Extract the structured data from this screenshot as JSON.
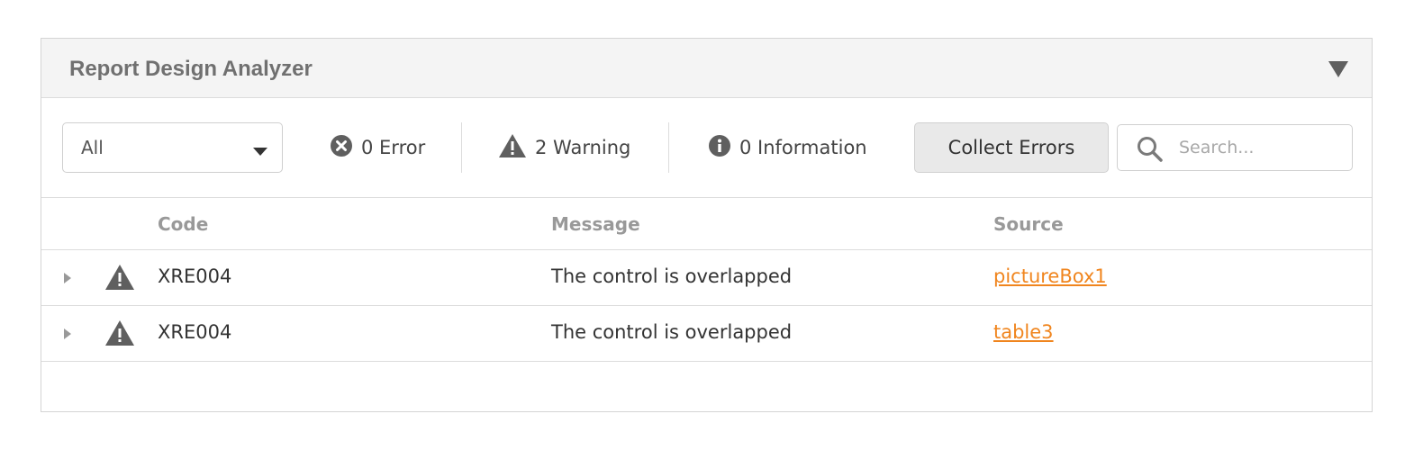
{
  "panel": {
    "title": "Report Design Analyzer"
  },
  "toolbar": {
    "filter": {
      "selected": "All"
    },
    "counters": {
      "error": "0 Error",
      "warning": "2 Warning",
      "information": "0 Information"
    },
    "collect_label": "Collect Errors",
    "search": {
      "placeholder": "Search...",
      "value": ""
    }
  },
  "table": {
    "columns": {
      "code": "Code",
      "message": "Message",
      "source": "Source"
    },
    "rows": [
      {
        "severity": "warning",
        "code": "XRE004",
        "message": "The control is overlapped",
        "source": "pictureBox1"
      },
      {
        "severity": "warning",
        "code": "XRE004",
        "message": "The control is overlapped",
        "source": "table3"
      }
    ]
  },
  "icons": {
    "collapse": "triangle-down-icon",
    "filter_caret": "caret-down-icon",
    "error": "error-circle-x-icon",
    "warning": "warning-triangle-icon",
    "information": "info-circle-icon",
    "search": "search-icon",
    "row_expand": "caret-right-icon"
  },
  "colors": {
    "header_bg": "#f4f4f4",
    "link": "#f0851e",
    "icon": "#5f5f5f",
    "column_header": "#999999"
  }
}
